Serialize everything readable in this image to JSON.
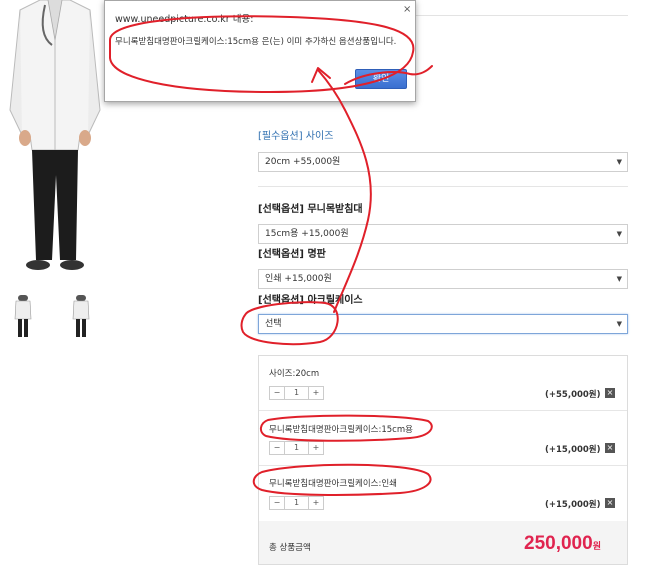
{
  "dialog": {
    "title": "www.uneedpicture.co.kr 내용:",
    "close": "×",
    "message": "무니록받침대명판아크릴케이스:15cm용 은(는) 이미 추가하신 옵션상품입니다.",
    "ok_label": "확인"
  },
  "options": {
    "size": {
      "tag": "[필수옵션]",
      "name": "사이즈",
      "selected": "20cm   +55,000원"
    },
    "stand": {
      "tag": "[선택옵션]",
      "name": "무니목받침대",
      "selected": "15cm용   +15,000원"
    },
    "nameplate": {
      "tag": "[선택옵션]",
      "name": "명판",
      "selected": "인쇄   +15,000원"
    },
    "acrylic": {
      "tag": "[선택옵션]",
      "name": "아크릴케이스",
      "selected": "선택"
    },
    "arrow": "▼"
  },
  "cart": {
    "rows": [
      {
        "label": "사이즈:20cm",
        "qty": "1",
        "price": "(+55,000원)"
      },
      {
        "label": "무니록받침대명판아크릴케이스:15cm용",
        "qty": "1",
        "price": "(+15,000원)"
      },
      {
        "label": "무니록받침대명판아크릴케이스:인쇄",
        "qty": "1",
        "price": "(+15,000원)"
      }
    ],
    "minus": "−",
    "plus": "+",
    "remove": "×",
    "total_label": "총 상품금액",
    "total_amount": "250,000",
    "total_unit": "원"
  },
  "colors": {
    "accent_blue": "#2f6fb0",
    "total_red": "#e0244f",
    "annotation_red": "#e0202a"
  }
}
